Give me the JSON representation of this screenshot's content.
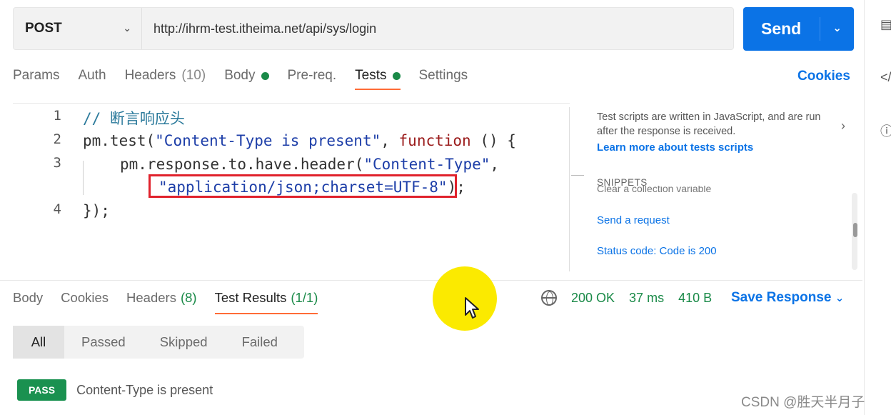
{
  "request": {
    "method": "POST",
    "url": "http://ihrm-test.itheima.net/api/sys/login",
    "send_label": "Send"
  },
  "request_tabs": [
    {
      "label": "Params",
      "count": "",
      "dot": false,
      "active": false
    },
    {
      "label": "Auth",
      "count": "",
      "dot": false,
      "active": false
    },
    {
      "label": "Headers",
      "count": "(10)",
      "dot": false,
      "active": false
    },
    {
      "label": "Body",
      "count": "",
      "dot": true,
      "active": false
    },
    {
      "label": "Pre-req.",
      "count": "",
      "dot": false,
      "active": false
    },
    {
      "label": "Tests",
      "count": "",
      "dot": true,
      "active": true
    },
    {
      "label": "Settings",
      "count": "",
      "dot": false,
      "active": false
    }
  ],
  "cookies_link": "Cookies",
  "editor": {
    "line_numbers": [
      "1",
      "2",
      "3",
      "",
      "4"
    ],
    "comment": "// 断言响应头",
    "l2_a": "pm.test(",
    "l2_str": "\"Content-Type is present\"",
    "l2_b": ", ",
    "l2_kw": "function",
    "l2_c": " () {",
    "l3_a": "pm.response.to.have.header(",
    "l3_str": "\"Content-Type\"",
    "l3_b": ",",
    "l3c_str": "\"application/json;charset=UTF-8\"",
    "l3c_b": ");",
    "l4": "});"
  },
  "side_panel": {
    "description": "Test scripts are written in JavaScript, and are run after the response is received.",
    "learn_more": "Learn more about tests scripts",
    "snippets_title": "SNIPPETS",
    "clipped_snippet": "Clear a collection variable",
    "snippets": [
      "Send a request",
      "Status code: Code is 200"
    ]
  },
  "response_tabs": [
    {
      "label": "Body",
      "count": "",
      "active": false
    },
    {
      "label": "Cookies",
      "count": "",
      "active": false
    },
    {
      "label": "Headers",
      "count": "(8)",
      "active": false
    },
    {
      "label": "Test Results",
      "count": "(1/1)",
      "active": true
    }
  ],
  "response_meta": {
    "status": "200 OK",
    "time": "37 ms",
    "size": "410 B",
    "save_label": "Save Response"
  },
  "filters": [
    "All",
    "Passed",
    "Skipped",
    "Failed"
  ],
  "results": [
    {
      "badge": "PASS",
      "name": "Content-Type is present"
    }
  ],
  "watermark": "CSDN @胜天半月子",
  "colors": {
    "accent": "#0b73e6",
    "active_tab": "#ff6c37",
    "pass": "#1a9150",
    "highlight_box": "#e0222c",
    "cursor_highlight": "#fbea00"
  }
}
